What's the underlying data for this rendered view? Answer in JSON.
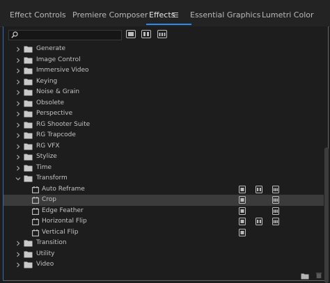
{
  "tabs": [
    {
      "label": "Effect Controls"
    },
    {
      "label": "Premiere Composer"
    },
    {
      "label": "Effects"
    },
    {
      "label": "Essential Graphics"
    },
    {
      "label": "Lumetri Color"
    }
  ],
  "active_tab": "Effects",
  "search": {
    "value": "",
    "placeholder": ""
  },
  "tree": {
    "folders_top": [
      {
        "label": "Generate"
      },
      {
        "label": "Image Control"
      },
      {
        "label": "Immersive Video"
      },
      {
        "label": "Keying"
      },
      {
        "label": "Noise & Grain"
      },
      {
        "label": "Obsolete"
      },
      {
        "label": "Perspective"
      },
      {
        "label": "RG Shooter Suite"
      },
      {
        "label": "RG Trapcode"
      },
      {
        "label": "RG VFX"
      },
      {
        "label": "Stylize"
      },
      {
        "label": "Time"
      }
    ],
    "expanded_folder": {
      "label": "Transform",
      "state": "expanded"
    },
    "effects": [
      {
        "label": "Auto Reframe",
        "accelerated": true,
        "bit32": true,
        "yuv": true,
        "selected": false
      },
      {
        "label": "Crop",
        "accelerated": true,
        "bit32": false,
        "yuv": true,
        "selected": true
      },
      {
        "label": "Edge Feather",
        "accelerated": true,
        "bit32": false,
        "yuv": true,
        "selected": false
      },
      {
        "label": "Horizontal Flip",
        "accelerated": true,
        "bit32": true,
        "yuv": true,
        "selected": false
      },
      {
        "label": "Vertical Flip",
        "accelerated": true,
        "bit32": false,
        "yuv": false,
        "selected": false
      }
    ],
    "folders_bottom": [
      {
        "label": "Transition"
      },
      {
        "label": "Utility"
      },
      {
        "label": "Video"
      }
    ]
  },
  "colors": {
    "accent": "#2d8ceb",
    "background": "#1d1d1d",
    "selected_row": "#3b3b3b",
    "text": "#c3c3c3"
  },
  "icons": {
    "filter_buttons": [
      "accelerated-effects-icon",
      "32-bit-color-icon",
      "yuv-effects-icon"
    ],
    "footer": [
      "new-bin-icon",
      "delete-icon"
    ]
  }
}
